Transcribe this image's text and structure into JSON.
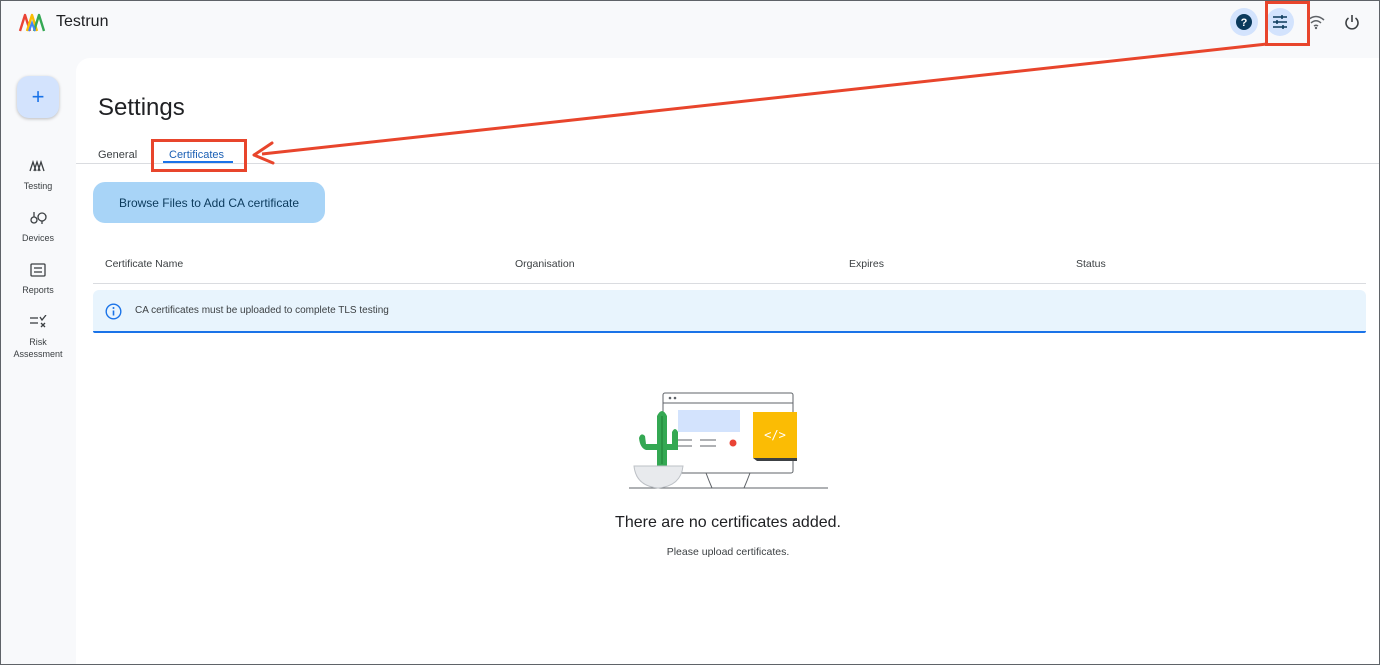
{
  "app": {
    "title": "Testrun"
  },
  "topbar": {
    "icons": [
      "help-icon",
      "settings-sliders-icon",
      "wifi-icon",
      "power-icon"
    ]
  },
  "sidenav": {
    "fab_label": "+",
    "items": [
      {
        "label": "Testing",
        "icon": "testing-icon"
      },
      {
        "label": "Devices",
        "icon": "devices-icon"
      },
      {
        "label": "Reports",
        "icon": "reports-icon"
      },
      {
        "label": "Risk Assessment",
        "icon": "risk-assessment-icon"
      }
    ]
  },
  "page": {
    "title": "Settings",
    "tabs": [
      {
        "label": "General",
        "selected": false
      },
      {
        "label": "Certificates",
        "selected": true
      }
    ],
    "browse_button": "Browse Files to Add CA certificate",
    "table": {
      "columns": [
        "Certificate Name",
        "Organisation",
        "Expires",
        "Status"
      ]
    },
    "notice": "CA certificates must be uploaded to complete TLS testing",
    "empty_state": {
      "title": "There are no certificates added.",
      "subtitle": "Please upload certificates."
    }
  },
  "colors": {
    "accent": "#1a73e8",
    "annotation": "#e8452c",
    "button_bg": "#a8d4f7",
    "notice_bg": "#e8f4fd"
  }
}
